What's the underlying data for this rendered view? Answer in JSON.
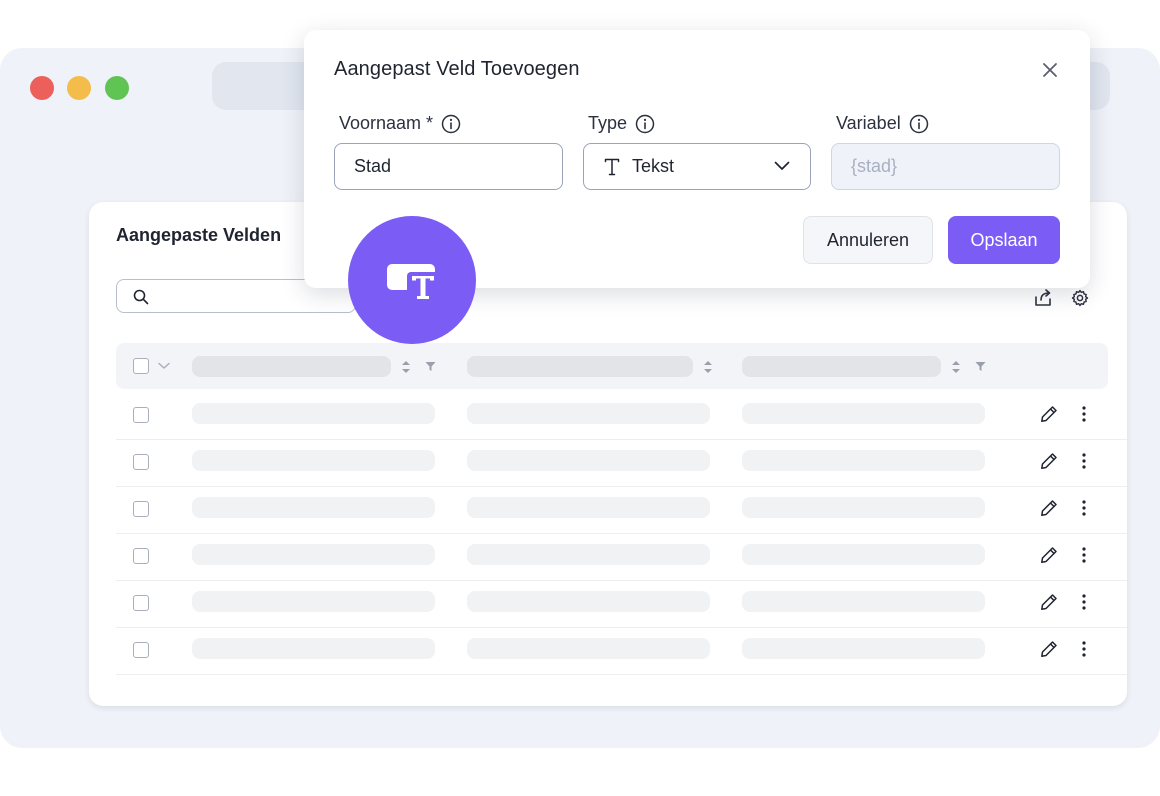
{
  "window": {
    "traffic_lights": [
      "#ec5f5a",
      "#f4bc4a",
      "#5fc454"
    ]
  },
  "card": {
    "title": "Aangepaste Velden",
    "search_placeholder": "",
    "icons": [
      "search-icon",
      "share-icon",
      "gear-icon"
    ],
    "row_count": 6
  },
  "dialog": {
    "title": "Aangepast Veld Toevoegen",
    "fields": {
      "name": {
        "label": "Voornaam *",
        "value": "Stad"
      },
      "type": {
        "label": "Type",
        "value": "Tekst"
      },
      "variable": {
        "label": "Variabel",
        "value": "{stad}"
      }
    },
    "cancel_label": "Annuleren",
    "save_label": "Opslaan"
  },
  "colors": {
    "accent": "#7b5cf5",
    "background": "#eff2f8"
  }
}
